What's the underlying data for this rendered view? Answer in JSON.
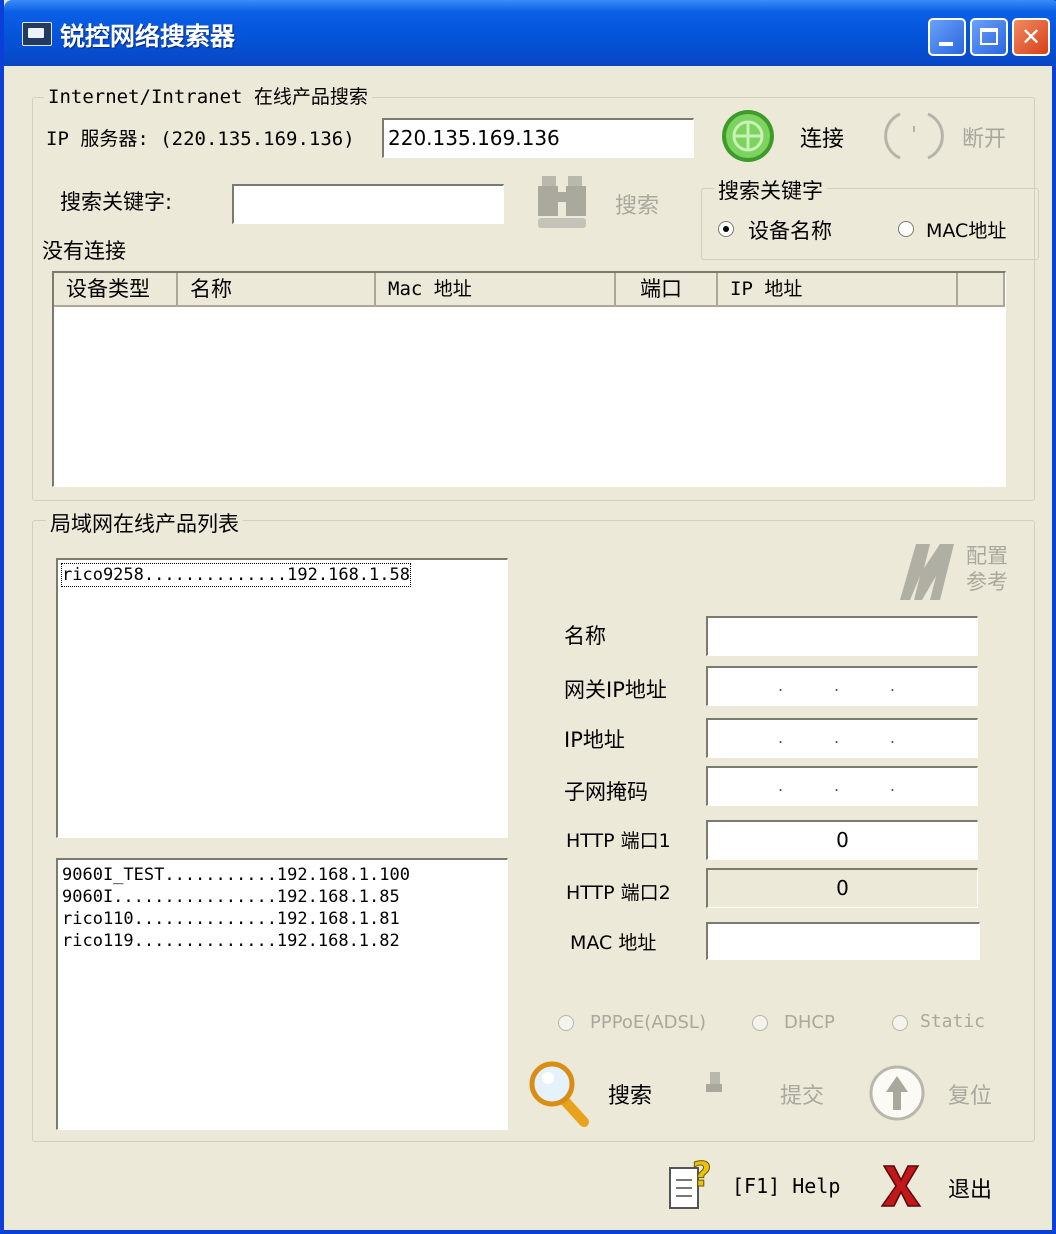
{
  "window": {
    "title": "锐控网络搜索器"
  },
  "internet_group": {
    "legend": "Internet/Intranet 在线产品搜索",
    "ip_server_label": "IP 服务器: (220.135.169.136)",
    "ip_server_value": "220.135.169.136",
    "connect_label": "连接",
    "disconnect_label": "断开",
    "keyword_label": "搜索关键字:",
    "keyword_value": "",
    "search_label": "搜索",
    "status_text": "没有连接",
    "keyword_group": {
      "legend": "搜索关键字",
      "option_device_name": "设备名称",
      "option_mac": "MAC地址",
      "selected": "设备名称"
    },
    "table": {
      "columns": [
        "设备类型",
        "名称",
        "Mac 地址",
        "端口",
        "IP 地址",
        ""
      ],
      "rows": []
    }
  },
  "lan_group": {
    "legend": "局域网在线产品列表",
    "list_top": [
      {
        "text": "rico9258..............192.168.1.58"
      }
    ],
    "list_bottom": [
      {
        "text": "9060I_TEST...........192.168.1.100"
      },
      {
        "text": "9060I................192.168.1.85"
      },
      {
        "text": "rico110..............192.168.1.81"
      },
      {
        "text": "rico119..............192.168.1.82"
      }
    ],
    "config_ref_label_1": "配置",
    "config_ref_label_2": "参考",
    "form": {
      "name_label": "名称",
      "name_value": "",
      "gateway_label": "网关IP地址",
      "gateway_dots": ".          .          .",
      "ip_label": "IP地址",
      "ip_dots": ".          .          .",
      "subnet_label": "子网掩码",
      "subnet_dots": ".          .          .",
      "http1_label": "HTTP 端口1",
      "http1_value": "0",
      "http2_label": "HTTP 端口2",
      "http2_value": "0",
      "mac_label": "MAC 地址",
      "mac_value": ""
    },
    "mode_options": {
      "pppoe": "PPPoE(ADSL)",
      "dhcp": "DHCP",
      "static": "Static"
    },
    "buttons": {
      "search": "搜索",
      "submit": "提交",
      "reset": "复位"
    }
  },
  "footer": {
    "help_label": "[F1] Help",
    "exit_label": "退出"
  },
  "colors": {
    "titlebar": "#0453d8",
    "window_bg": "#ece9d8",
    "connect_green": "#4caf3a"
  },
  "icons": [
    "connect-globe-icon",
    "disconnect-icon",
    "binoculars-icon",
    "config-logo-icon",
    "magnifier-icon",
    "submit-icon",
    "reset-up-arrow-icon",
    "help-icon",
    "exit-x-icon"
  ]
}
